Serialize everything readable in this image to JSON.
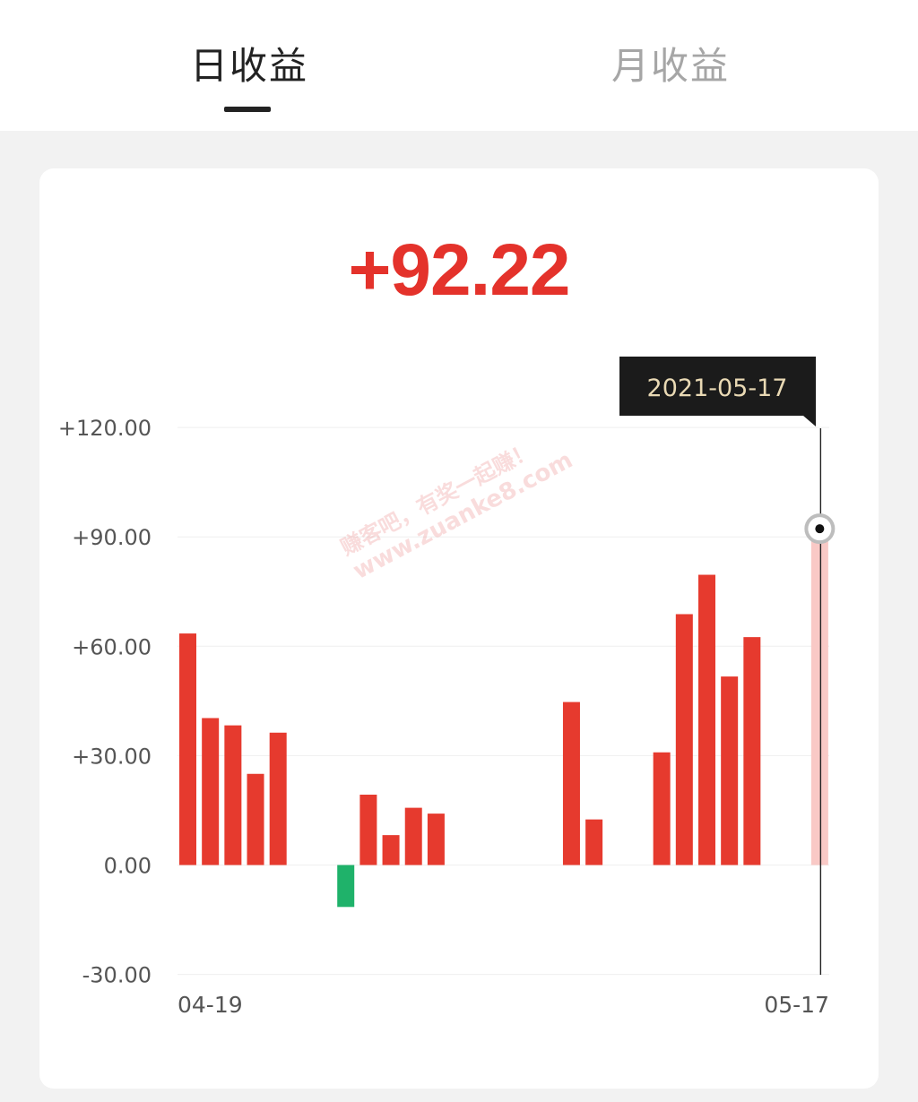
{
  "tabs": {
    "daily_label": "日收益",
    "monthly_label": "月收益",
    "active": "daily"
  },
  "summary": {
    "value": "+92.22"
  },
  "tooltip": {
    "date": "2021-05-17"
  },
  "watermark": {
    "line1": "赚客吧，有奖一起赚！",
    "line2": "www.zuanke8.com"
  },
  "colors": {
    "positive": "#e63a2e",
    "negative": "#1fb26a",
    "highlight": "#f9c9c6",
    "accent_text": "#e4322b"
  },
  "chart_data": {
    "type": "bar",
    "title": "",
    "xlabel": "",
    "ylabel": "",
    "ylim": [
      -30,
      120
    ],
    "y_ticks": [
      "+120.00",
      "+90.00",
      "+60.00",
      "+30.00",
      "0.00",
      "-30.00"
    ],
    "y_tick_values": [
      120,
      90,
      60,
      30,
      0,
      -30
    ],
    "x_tick_labels": [
      "04-19",
      "05-17"
    ],
    "categories": [
      "04-19",
      "04-20",
      "04-21",
      "04-22",
      "04-23",
      "04-24",
      "04-25",
      "04-26",
      "04-27",
      "04-28",
      "04-29",
      "04-30",
      "05-01",
      "05-02",
      "05-03",
      "05-04",
      "05-05",
      "05-06",
      "05-07",
      "05-08",
      "05-09",
      "05-10",
      "05-11",
      "05-12",
      "05-13",
      "05-14",
      "05-15",
      "05-16",
      "05-17"
    ],
    "values": [
      63.5,
      40.3,
      38.3,
      25.0,
      36.3,
      null,
      null,
      -11.5,
      19.3,
      8.2,
      15.7,
      14.1,
      null,
      null,
      null,
      null,
      null,
      44.7,
      12.5,
      null,
      null,
      30.9,
      68.8,
      79.6,
      51.7,
      62.5,
      null,
      null,
      92.22
    ],
    "selected_index": 28,
    "grid": true,
    "legend": "none"
  }
}
